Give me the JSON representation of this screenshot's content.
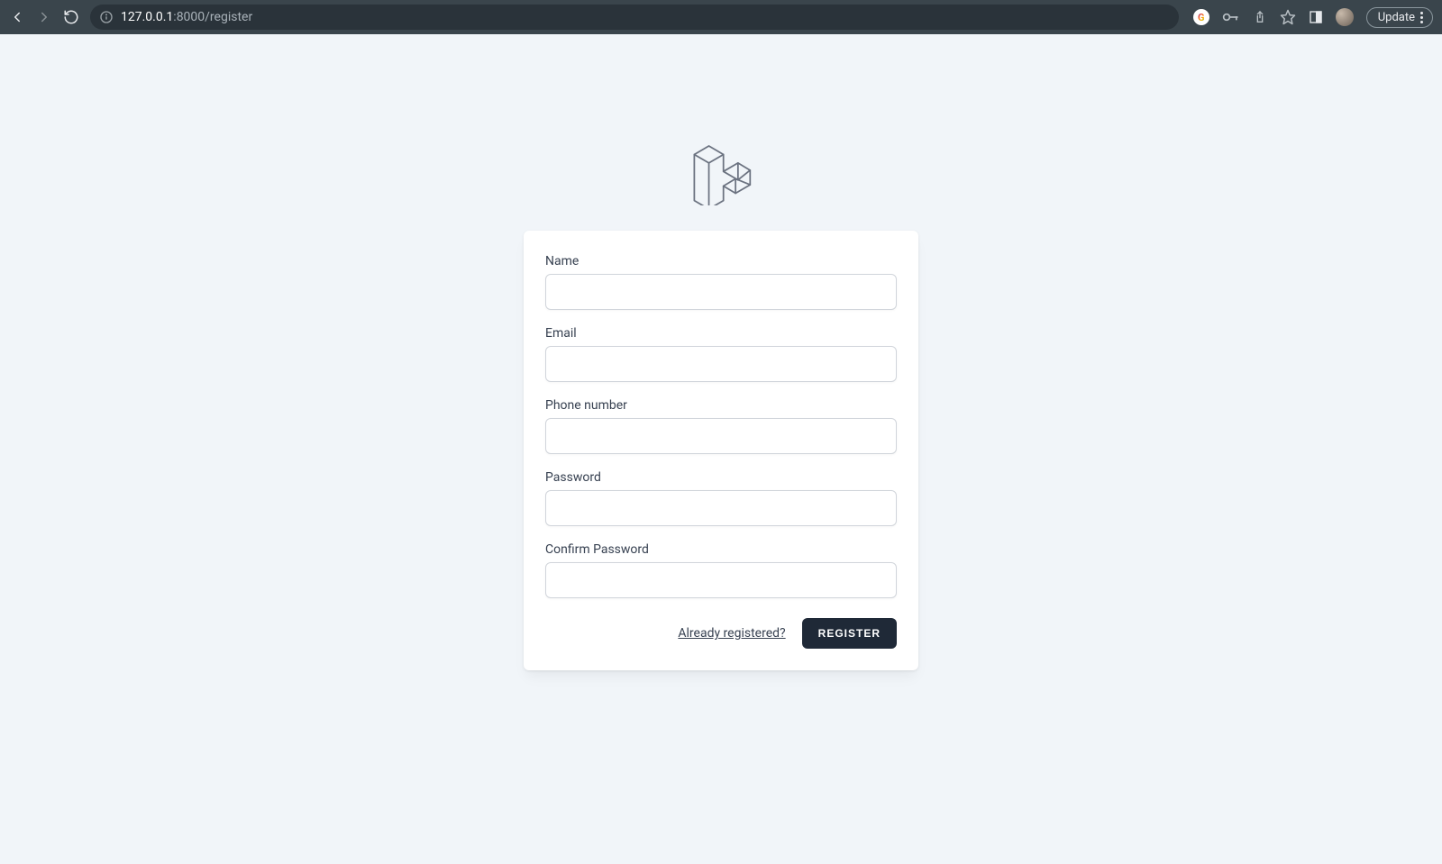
{
  "browser": {
    "url_host": "127.0.0.1",
    "url_port_path": ":8000/register",
    "update_label": "Update"
  },
  "form": {
    "name_label": "Name",
    "email_label": "Email",
    "phone_label": "Phone number",
    "password_label": "Password",
    "confirm_label": "Confirm Password",
    "already_link": "Already registered?",
    "submit_label": "REGISTER",
    "values": {
      "name": "",
      "email": "",
      "phone": "",
      "password": "",
      "confirm": ""
    }
  }
}
